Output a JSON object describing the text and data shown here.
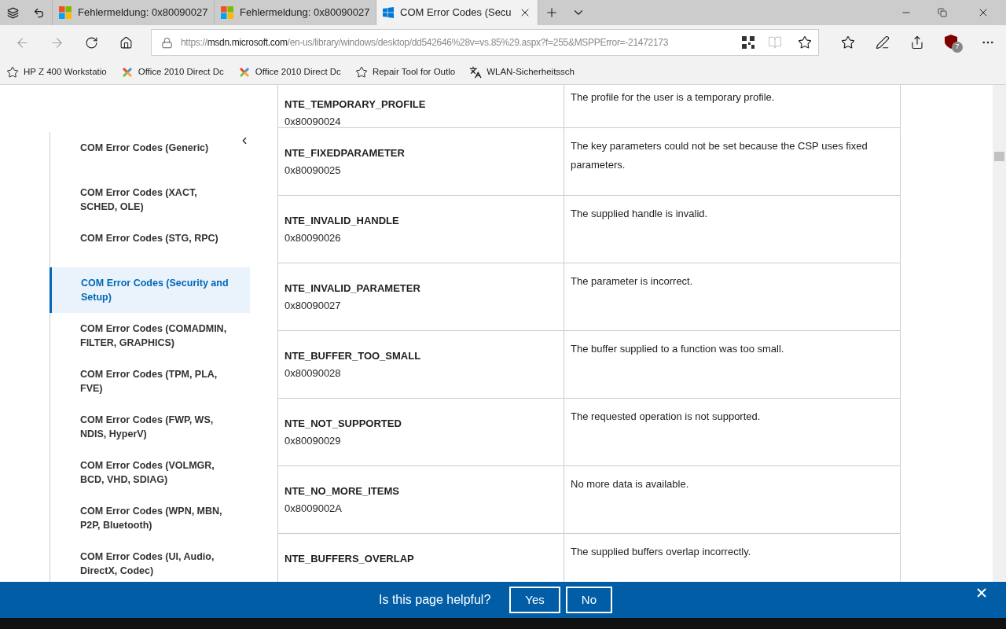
{
  "tabs": [
    {
      "title": "Fehlermeldung: 0x80090027",
      "selected": false,
      "kind": "ms"
    },
    {
      "title": "Fehlermeldung: 0x80090027",
      "selected": false,
      "kind": "ms"
    },
    {
      "title": "COM Error Codes (Secu",
      "selected": true,
      "kind": "win"
    }
  ],
  "address": {
    "prefix": "https://",
    "host": "msdn.microsoft.com",
    "path": "/en-us/library/windows/desktop/dd542646%28v=vs.85%29.aspx?f=255&MSPPError=-21472173"
  },
  "extension_badge": "7",
  "favorites": [
    {
      "label": "HP Z 400 Workstatio",
      "kind": "star"
    },
    {
      "label": "Office 2010 Direct Dc",
      "kind": "joomla"
    },
    {
      "label": "Office 2010 Direct Dc",
      "kind": "joomla"
    },
    {
      "label": "Repair Tool for Outlo",
      "kind": "star"
    },
    {
      "label": "WLAN-Sicherheitssch",
      "kind": "font"
    }
  ],
  "sidebar": {
    "items": [
      {
        "label": "COM Error Codes (Generic)",
        "selected": false
      },
      {
        "label": "COM Error Codes (XACT, SCHED, OLE)",
        "selected": false
      },
      {
        "label": "COM Error Codes (STG, RPC)",
        "selected": false
      },
      {
        "label": "COM Error Codes (Security and Setup)",
        "selected": true
      },
      {
        "label": "COM Error Codes (COMADMIN, FILTER, GRAPHICS)",
        "selected": false
      },
      {
        "label": "COM Error Codes (TPM, PLA, FVE)",
        "selected": false
      },
      {
        "label": "COM Error Codes (FWP, WS, NDIS, HyperV)",
        "selected": false
      },
      {
        "label": "COM Error Codes (VOLMGR, BCD, VHD, SDIAG)",
        "selected": false
      },
      {
        "label": "COM Error Codes (WPN, MBN, P2P, Bluetooth)",
        "selected": false
      },
      {
        "label": "COM Error Codes (UI, Audio, DirectX, Codec)",
        "selected": false
      }
    ]
  },
  "table": {
    "rows": [
      {
        "name": "NTE_TEMPORARY_PROFILE",
        "code": "0x80090024",
        "description": "The profile for the user is a temporary profile."
      },
      {
        "name": "NTE_FIXEDPARAMETER",
        "code": "0x80090025",
        "description": "The key parameters could not be set because the CSP uses fixed parameters."
      },
      {
        "name": "NTE_INVALID_HANDLE",
        "code": "0x80090026",
        "description": "The supplied handle is invalid."
      },
      {
        "name": "NTE_INVALID_PARAMETER",
        "code": "0x80090027",
        "description": "The parameter is incorrect."
      },
      {
        "name": "NTE_BUFFER_TOO_SMALL",
        "code": "0x80090028",
        "description": "The buffer supplied to a function was too small."
      },
      {
        "name": "NTE_NOT_SUPPORTED",
        "code": "0x80090029",
        "description": "The requested operation is not supported."
      },
      {
        "name": "NTE_NO_MORE_ITEMS",
        "code": "0x8009002A",
        "description": "No more data is available."
      },
      {
        "name": "NTE_BUFFERS_OVERLAP",
        "description": "The supplied buffers overlap incorrectly."
      }
    ]
  },
  "feedback": {
    "question": "Is this page helpful?",
    "buttons": [
      "Yes",
      "No"
    ]
  }
}
